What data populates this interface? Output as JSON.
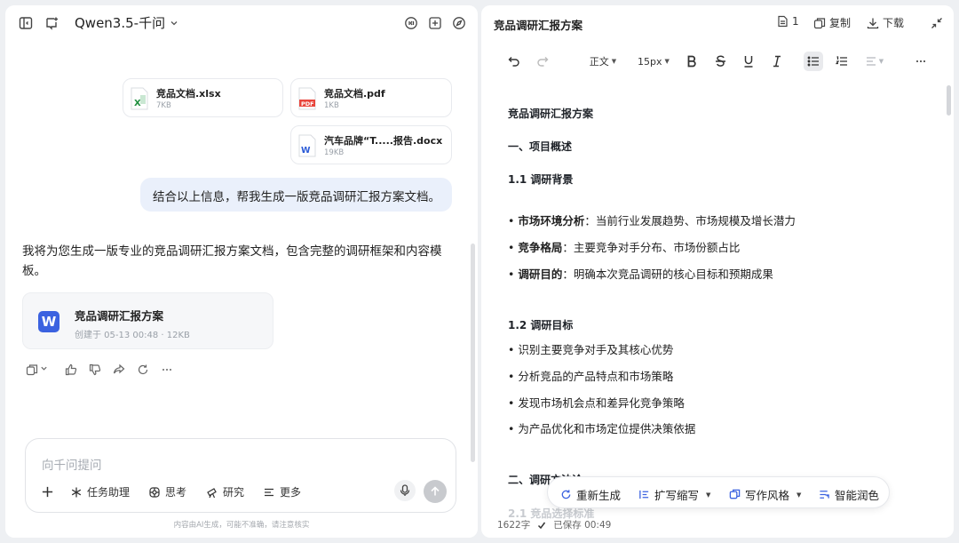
{
  "header": {
    "model_name": "Qwen3.5-千问",
    "icons": [
      "sidebar-toggle-icon",
      "new-chat-icon",
      "chevron-down-icon",
      "history-icon",
      "grid-icon",
      "compass-icon"
    ]
  },
  "attachments": [
    {
      "name": "竞品文档.xlsx",
      "size": "7KB",
      "type": "xlsx"
    },
    {
      "name": "竞品文档.pdf",
      "size": "1KB",
      "type": "pdf"
    },
    {
      "name": "汽车品牌“T.....报告.docx",
      "size": "19KB",
      "type": "docx"
    }
  ],
  "user_message": "结合以上信息，帮我生成一版竞品调研汇报方案文档。",
  "assistant": {
    "reply": "我将为您生成一版专业的竞品调研汇报方案文档，包含完整的调研框架和内容模板。",
    "doc_card": {
      "title": "竞品调研汇报方案",
      "meta": "创建于 05-13 00:48 · 12KB"
    },
    "actions": [
      "copy-icon",
      "like-icon",
      "dislike-icon",
      "share-icon",
      "regenerate-icon",
      "more-icon"
    ]
  },
  "composer": {
    "placeholder": "向千问提问",
    "tools": [
      "任务助理",
      "思考",
      "研究",
      "更多"
    ],
    "disclaimer": "内容由AI生成，可能不准确，请注意核实"
  },
  "editor": {
    "title": "竞品调研汇报方案",
    "count_label": "1",
    "copy_label": "复制",
    "download_label": "下载",
    "style_select": "正文",
    "font_size": "15px",
    "doc": {
      "title": "竞品调研汇报方案",
      "s1": "一、项目概述",
      "s1_1": "1.1 调研背景",
      "b1_label": "市场环境分析",
      "b1_text": "：当前行业发展趋势、市场规模及增长潜力",
      "b2_label": "竞争格局",
      "b2_text": "：主要竞争对手分布、市场份额占比",
      "b3_label": "调研目的",
      "b3_text": "：明确本次竞品调研的核心目标和预期成果",
      "s1_2": "1.2 调研目标",
      "g1": "• 识别主要竞争对手及其核心优势",
      "g2": "• 分析竞品的产品特点和市场策略",
      "g3": "• 发现市场机会点和差异化竞争策略",
      "g4": "• 为产品优化和市场定位提供决策依据",
      "s2": "二、调研方法论",
      "s2_1": "2.1 竞品选择标准"
    },
    "floating_toolbar": [
      "重新生成",
      "扩写缩写",
      "写作风格",
      "智能润色"
    ],
    "status": {
      "word_count": "1622字",
      "saved": "已保存 00:49"
    }
  }
}
